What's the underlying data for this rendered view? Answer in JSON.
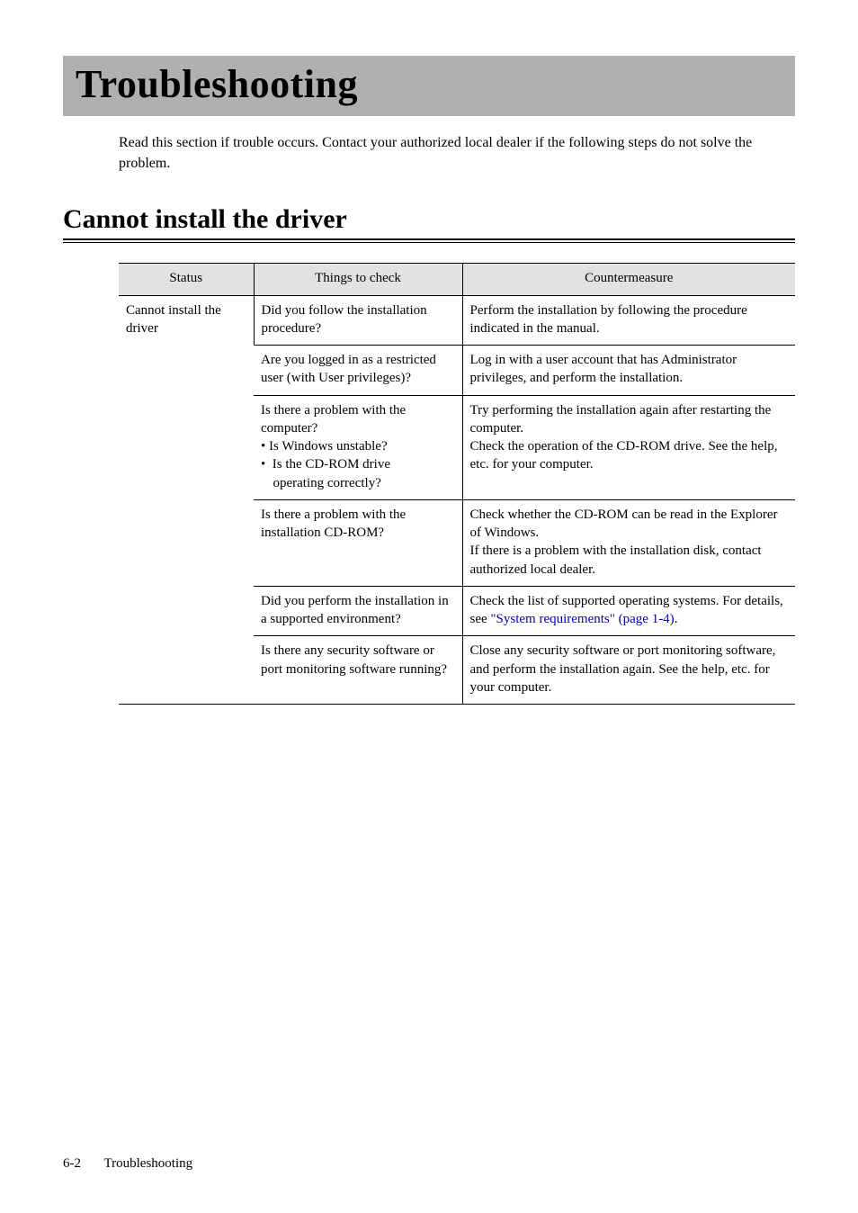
{
  "title": "Troubleshooting",
  "intro": "Read this section if trouble occurs.  Contact your authorized local dealer if the following steps do not solve the problem.",
  "section_heading": "Cannot install the driver",
  "table": {
    "headers": {
      "status": "Status",
      "things": "Things to check",
      "counter": "Countermeasure"
    },
    "status_cell": "Cannot install the driver",
    "rows": [
      {
        "things_text": "Did you follow the installation procedure?",
        "counter_text": "Perform the installation by following the procedure indicated in the manual."
      },
      {
        "things_text": "Are you logged in as a restricted user (with User privileges)?",
        "counter_text": "Log in with a user account that has Administrator privileges, and perform the installation."
      },
      {
        "things_lead": "Is there a problem with the computer?",
        "things_bullets": [
          "Is Windows unstable?"
        ],
        "things_bullet_last_line1": "Is the CD-ROM drive",
        "things_bullet_last_line2": "operating correctly?",
        "counter_text": "Try performing the installation again after restarting the computer.\nCheck the operation of the CD-ROM drive.  See the help, etc. for your computer."
      },
      {
        "things_text": "Is there a problem with the installation CD-ROM?",
        "counter_text": "Check whether the CD-ROM can be read in the Explorer of Windows.\nIf there is a problem with the installation disk, contact authorized local dealer."
      },
      {
        "things_text": "Did you perform the installation in a supported environment?",
        "counter_pre": "Check the list of supported operating systems.  For details, see ",
        "counter_link": "\"System requirements\" (page 1-4)",
        "counter_post": "."
      },
      {
        "things_text": "Is there any security software or port monitoring software running?",
        "counter_text": "Close any security software or port monitoring software, and perform the installation again.  See the help, etc. for your computer."
      }
    ]
  },
  "footer": {
    "page": "6-2",
    "label": "Troubleshooting"
  }
}
